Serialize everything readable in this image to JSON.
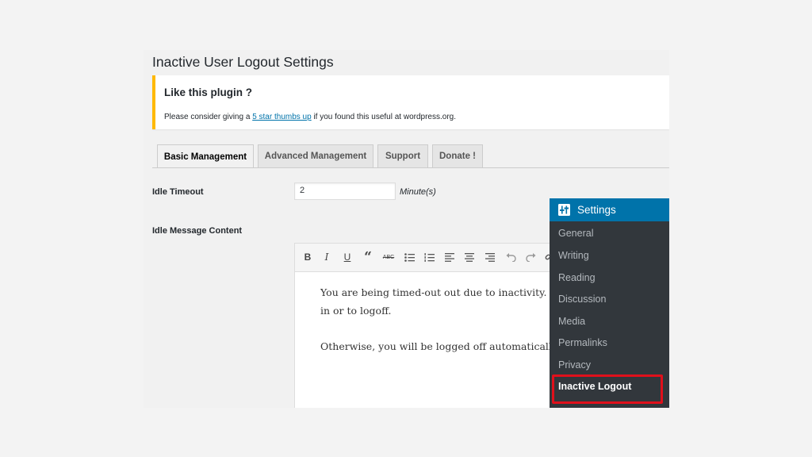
{
  "page": {
    "title": "Inactive User Logout Settings"
  },
  "notice": {
    "title": "Like this plugin ?",
    "text_before": "Please consider giving a ",
    "link_text": "5 star thumbs up",
    "text_after": " if you found this useful at wordpress.org."
  },
  "tabs": [
    {
      "label": "Basic Management",
      "active": true
    },
    {
      "label": "Advanced Management",
      "active": false
    },
    {
      "label": "Support",
      "active": false
    },
    {
      "label": "Donate !",
      "active": false
    }
  ],
  "form": {
    "idle_timeout": {
      "label": "Idle Timeout",
      "value": "2",
      "unit": "Minute(s)"
    },
    "idle_message": {
      "label": "Idle Message Content",
      "toolbar": [
        "bold-icon",
        "italic-icon",
        "underline-icon",
        "blockquote-icon",
        "strikethrough-icon",
        "bullet-list-icon",
        "numbered-list-icon",
        "align-left-icon",
        "align-center-icon",
        "align-right-icon",
        "undo-icon",
        "redo-icon",
        "link-icon"
      ],
      "lines": [
        "You are being timed-out out due to inactivity.",
        "in or to logoff.",
        "Otherwise, you will be logged off automaticall"
      ]
    }
  },
  "admin_menu": {
    "header": "Settings",
    "header_icon": "settings-icon",
    "items": [
      {
        "label": "General",
        "current": false
      },
      {
        "label": "Writing",
        "current": false
      },
      {
        "label": "Reading",
        "current": false
      },
      {
        "label": "Discussion",
        "current": false
      },
      {
        "label": "Media",
        "current": false
      },
      {
        "label": "Permalinks",
        "current": false
      },
      {
        "label": "Privacy",
        "current": false
      },
      {
        "label": "Inactive Logout",
        "current": true
      }
    ],
    "highlight_color": "#e0101b",
    "header_color": "#0073aa"
  },
  "colors": {
    "notice_border": "#ffb900",
    "link": "#0073aa",
    "menu_bg": "#32373c"
  }
}
